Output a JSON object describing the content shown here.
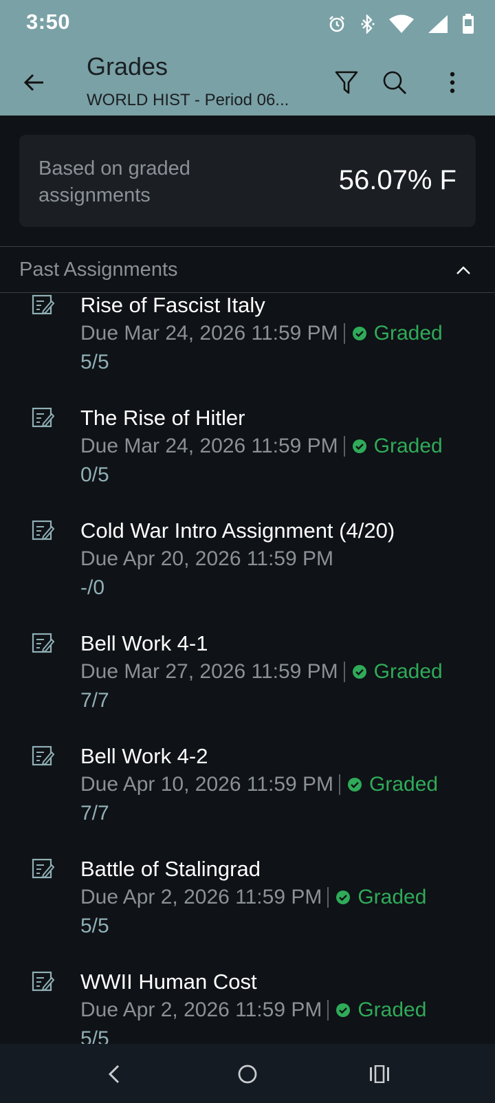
{
  "status_bar": {
    "time": "3:50",
    "icons": [
      "alarm-icon",
      "bluetooth-icon",
      "wifi-icon",
      "signal-icon",
      "battery-icon"
    ]
  },
  "header": {
    "title": "Grades",
    "subtitle": "WORLD HIST - Period 06...",
    "actions": [
      "back-icon",
      "filter-icon",
      "search-icon",
      "more-vert-icon"
    ]
  },
  "summary": {
    "label": "Based on graded assignments",
    "grade": "56.07% F"
  },
  "section": {
    "title": "Past Assignments",
    "collapse_icon": "chevron-up-icon"
  },
  "assignments": [
    {
      "name": "Rise of Fascist Italy",
      "due": "Due Mar 24, 2026 11:59 PM",
      "status": "Graded",
      "score": "5/5"
    },
    {
      "name": "The Rise of Hitler",
      "due": "Due Mar 24, 2026 11:59 PM",
      "status": "Graded",
      "score": "0/5"
    },
    {
      "name": "Cold War Intro Assignment (4/20)",
      "due": "Due Apr 20, 2026 11:59 PM",
      "status": "",
      "score": "-/0"
    },
    {
      "name": "Bell Work 4-1",
      "due": "Due Mar 27, 2026 11:59 PM",
      "status": "Graded",
      "score": "7/7"
    },
    {
      "name": "Bell Work 4-2",
      "due": "Due Apr 10, 2026 11:59 PM",
      "status": "Graded",
      "score": "7/7"
    },
    {
      "name": "Battle of Stalingrad",
      "due": "Due Apr 2, 2026 11:59 PM",
      "status": "Graded",
      "score": "5/5"
    },
    {
      "name": "WWII Human Cost",
      "due": "Due Apr 2, 2026 11:59 PM",
      "status": "Graded",
      "score": "5/5"
    }
  ],
  "nav_bar": {
    "buttons": [
      "back-nav-icon",
      "home-nav-icon",
      "recents-nav-icon"
    ]
  },
  "colors": {
    "header_bg": "#7aa1a6",
    "page_bg": "#0f1216",
    "card_bg": "#1b1f24",
    "graded_green": "#2fab59",
    "score_teal": "#8fb0b6",
    "muted_text": "#8a9197"
  }
}
